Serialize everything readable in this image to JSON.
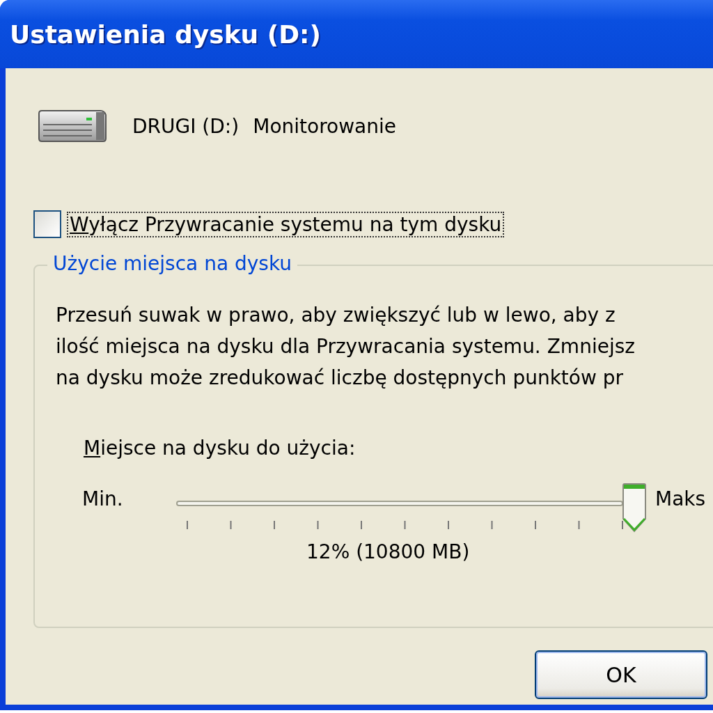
{
  "window": {
    "title": "Ustawienia dysku (D:)"
  },
  "drive": {
    "name": "DRUGI (D:)",
    "status": "Monitorowanie"
  },
  "disable_checkbox": {
    "label": "Wyłącz Przywracanie systemu na tym dysku",
    "checked": false,
    "focused": true
  },
  "disk_usage": {
    "title": "Użycie miejsca na dysku",
    "description": [
      "Przesuń suwak w prawo, aby zwiększyć lub w lewo, aby z",
      "ilość miejsca na dysku dla Przywracania systemu. Zmniejsz",
      "na dysku może zredukować liczbę dostępnych punktów pr"
    ],
    "slider_label": "Miejsce na dysku do użycia:",
    "min_label": "Min.",
    "max_label": "Maks",
    "reading": "12% (10800 MB)"
  },
  "buttons": [
    {
      "label": "OK"
    }
  ]
}
